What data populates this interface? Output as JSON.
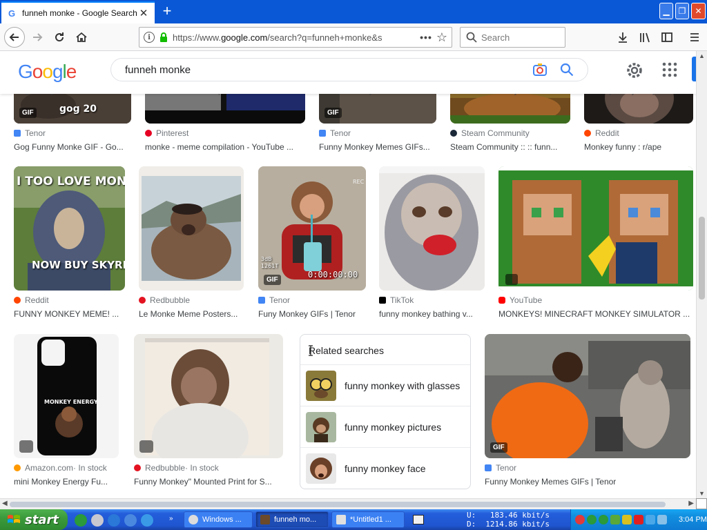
{
  "browser": {
    "tab_title": "funneh monke - Google Search",
    "new_tab": "+",
    "url_prefix": "https://www.",
    "url_host": "google.com",
    "url_rest": "/search?q=funneh+monke&s",
    "search_placeholder": "Search"
  },
  "google": {
    "logo_letters": [
      "G",
      "o",
      "o",
      "g",
      "l",
      "e"
    ],
    "logo_colors": [
      "#4285f4",
      "#ea4335",
      "#fbbc05",
      "#4285f4",
      "#34a853",
      "#ea4335"
    ],
    "query": "funneh monke"
  },
  "row1": [
    {
      "source": "Tenor",
      "title": "Gog Funny Monke GIF - Go...",
      "overlay": "gog 20",
      "badge": "GIF"
    },
    {
      "source": "Pinterest",
      "title": "monke - meme compilation - YouTube ..."
    },
    {
      "source": "Tenor",
      "title": "Funny Monkey Memes GIFs...",
      "badge": "GIF"
    },
    {
      "source": "Steam Community",
      "title": "Steam Community :: :: funn..."
    },
    {
      "source": "Reddit",
      "title": "Monkey funny : r/ape"
    }
  ],
  "row1_cut_titles": [
    "Gog Funny Monke GIF - Go...",
    "monke - meme compilation - YouTube",
    "Funny Monkey Memes GIFs",
    "Steam Community :: :: funn...",
    "Monkey funny : r/ape"
  ],
  "row2": [
    {
      "source": "Reddit",
      "title": "FUNNY MONKEY MEME! ...",
      "overlay_top": "I TOO LOVE MONKI",
      "overlay_bottom": "NOW BUY SKYRIM"
    },
    {
      "source": "Redbubble",
      "title": "Le Monke Meme Posters..."
    },
    {
      "source": "Tenor",
      "title": "Funy Monkey GIFs | Tenor",
      "badge": "GIF",
      "rec": "REC",
      "timestamp": "0:00:00:00",
      "cam_text_1": "3dB",
      "cam_text_2": "1261T"
    },
    {
      "source": "TikTok",
      "title": "funny monkey bathing v..."
    },
    {
      "source": "YouTube",
      "title": "MONKEYS! MINECRAFT MONKEY SIMULATOR ..."
    }
  ],
  "row3": [
    {
      "source": "Amazon.com",
      "stock": " · In stock",
      "title": "mini Monkey Energy Fu...",
      "phone_text": "MONKEY ENERGY"
    },
    {
      "source": "Redbubble",
      "stock": " · In stock",
      "title": "Funny Monkey\" Mounted Print for S..."
    },
    {
      "source": "Tenor",
      "title": "Funny Monkey Memes GIFs | Tenor",
      "badge": "GIF"
    }
  ],
  "related": {
    "heading": "Related searches",
    "items": [
      "funny monkey with glasses",
      "funny monkey pictures",
      "funny monkey face"
    ]
  },
  "taskbar": {
    "start": "start",
    "tasks": [
      "Windows ...",
      "funneh mo...",
      "*Untitled1 ..."
    ],
    "net_up_label": "U:",
    "net_up": "183.46 kbit/s",
    "net_down_label": "D:",
    "net_down": "1214.86 kbit/s",
    "clock": "3:04 PM"
  }
}
